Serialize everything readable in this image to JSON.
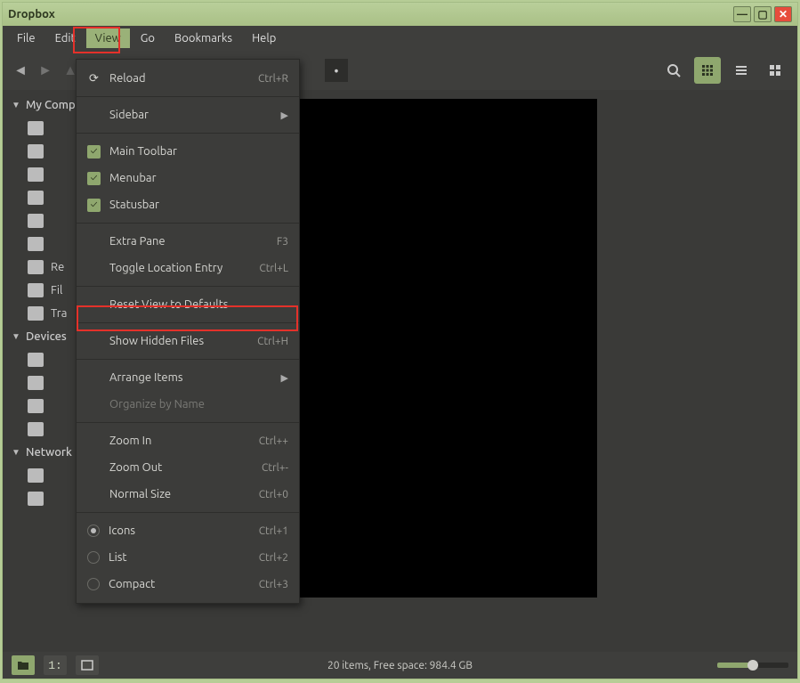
{
  "window_title": "Dropbox",
  "menubar": [
    "File",
    "Edit",
    "View",
    "Go",
    "Bookmarks",
    "Help"
  ],
  "active_menu_index": 2,
  "toolbar": {
    "view_modes": [
      "icon-grid",
      "icon-list",
      "icon-compact"
    ],
    "active_view_mode": 0
  },
  "sidebar": {
    "sections": [
      {
        "label": "My Computer",
        "items": [
          {
            "label": ""
          },
          {
            "label": ""
          },
          {
            "label": ""
          },
          {
            "label": ""
          },
          {
            "label": ""
          },
          {
            "label": ""
          },
          {
            "label": "Re"
          },
          {
            "label": "Fil"
          },
          {
            "label": "Tra"
          }
        ]
      },
      {
        "label": "Devices",
        "items": [
          {
            "label": ""
          },
          {
            "label": ""
          },
          {
            "label": ""
          },
          {
            "label": ""
          }
        ]
      },
      {
        "label": "Network",
        "items": [
          {
            "label": ""
          },
          {
            "label": ""
          }
        ]
      }
    ]
  },
  "dropdown": {
    "items": [
      {
        "type": "item",
        "label": "Reload",
        "accel": "Ctrl+R",
        "icon": "reload-icon"
      },
      {
        "type": "sep"
      },
      {
        "type": "submenu",
        "label": "Sidebar"
      },
      {
        "type": "sep"
      },
      {
        "type": "check",
        "label": "Main Toolbar",
        "checked": true
      },
      {
        "type": "check",
        "label": "Menubar",
        "checked": true
      },
      {
        "type": "check",
        "label": "Statusbar",
        "checked": true
      },
      {
        "type": "sep"
      },
      {
        "type": "item",
        "label": "Extra Pane",
        "accel": "F3"
      },
      {
        "type": "item",
        "label": "Toggle Location Entry",
        "accel": "Ctrl+L"
      },
      {
        "type": "sep"
      },
      {
        "type": "item",
        "label": "Reset View to Defaults"
      },
      {
        "type": "sep"
      },
      {
        "type": "item",
        "label": "Show Hidden Files",
        "accel": "Ctrl+H",
        "highlight": true
      },
      {
        "type": "sep"
      },
      {
        "type": "submenu",
        "label": "Arrange Items"
      },
      {
        "type": "item",
        "label": "Organize by Name",
        "disabled": true
      },
      {
        "type": "sep"
      },
      {
        "type": "item",
        "label": "Zoom In",
        "accel": "Ctrl++"
      },
      {
        "type": "item",
        "label": "Zoom Out",
        "accel": "Ctrl+-"
      },
      {
        "type": "item",
        "label": "Normal Size",
        "accel": "Ctrl+0"
      },
      {
        "type": "sep"
      },
      {
        "type": "radio",
        "label": "Icons",
        "accel": "Ctrl+1",
        "checked": true
      },
      {
        "type": "radio",
        "label": "List",
        "accel": "Ctrl+2",
        "checked": false
      },
      {
        "type": "radio",
        "label": "Compact",
        "accel": "Ctrl+3",
        "checked": false
      }
    ]
  },
  "statusbar": {
    "text": "20 items, Free space: 984.4 GB"
  }
}
